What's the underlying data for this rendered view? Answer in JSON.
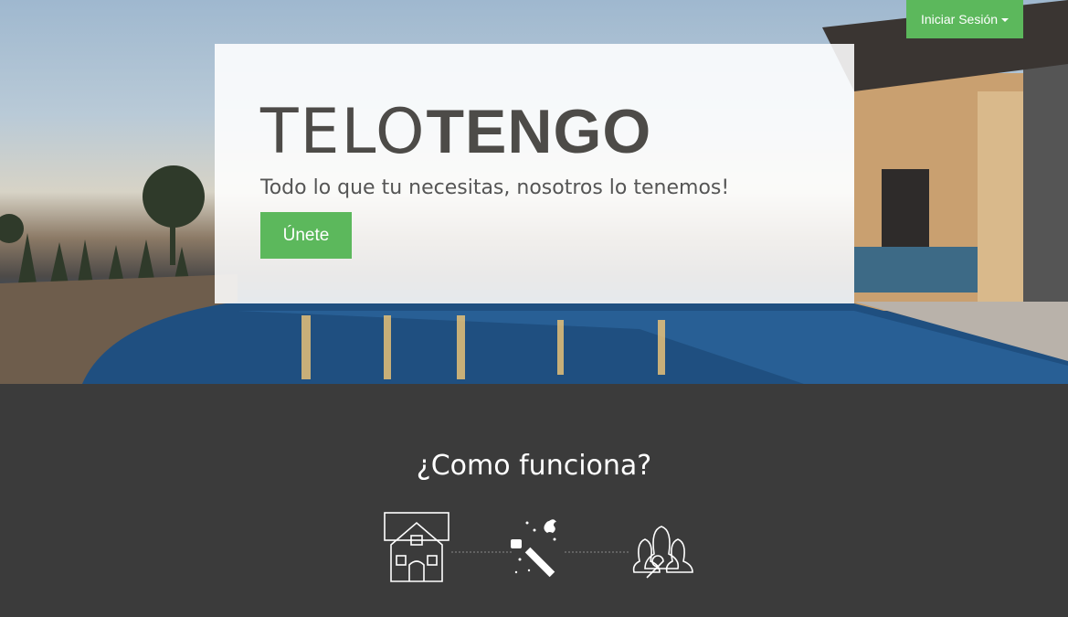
{
  "header": {
    "login_label": "Iniciar Sesión"
  },
  "hero": {
    "brand_light": "TELO",
    "brand_bold": "TENGO",
    "tagline": "Todo lo que tu necesitas, nosotros lo tenemos!",
    "join_label": "Únete"
  },
  "how": {
    "title": "¿Como funciona?",
    "steps": [
      {
        "icon": "house-icon"
      },
      {
        "icon": "magic-wand-icon"
      },
      {
        "icon": "people-tools-icon"
      }
    ]
  },
  "colors": {
    "accent": "#5cb85c",
    "dark": "#3b3b3b"
  }
}
